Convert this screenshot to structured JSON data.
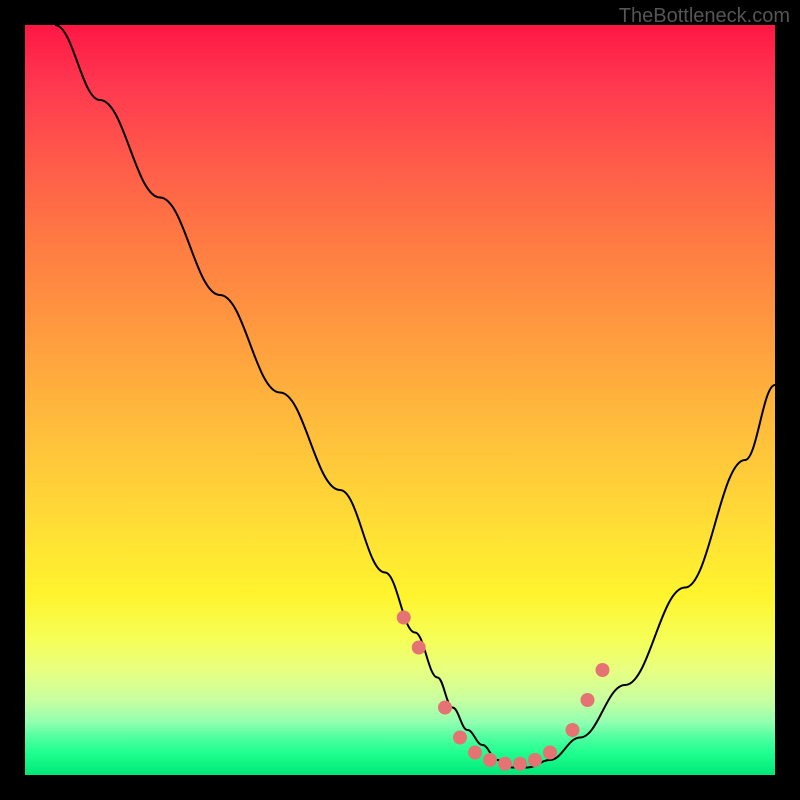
{
  "watermark": "TheBottleneck.com",
  "chart_data": {
    "type": "line",
    "title": "",
    "xlabel": "",
    "ylabel": "",
    "xlim": [
      0,
      100
    ],
    "ylim": [
      0,
      100
    ],
    "series": [
      {
        "name": "curve",
        "x": [
          4,
          10,
          18,
          26,
          34,
          42,
          48,
          52,
          55,
          57,
          59,
          61,
          63,
          65,
          67,
          70,
          74,
          80,
          88,
          96,
          100
        ],
        "values": [
          100,
          90,
          77,
          64,
          51,
          38,
          27,
          19,
          13,
          9,
          6,
          4,
          2,
          1,
          1,
          2,
          5,
          12,
          25,
          42,
          52
        ]
      }
    ],
    "markers": {
      "name": "dots",
      "x": [
        50.5,
        52.5,
        56,
        58,
        60,
        62,
        64,
        66,
        68,
        70,
        73,
        75,
        77
      ],
      "values": [
        21,
        17,
        9,
        5,
        3,
        2,
        1.5,
        1.5,
        2,
        3,
        6,
        10,
        14
      ]
    },
    "gradient_colors": {
      "top": "#ff1744",
      "middle": "#ffe135",
      "bottom": "#00e878"
    }
  }
}
